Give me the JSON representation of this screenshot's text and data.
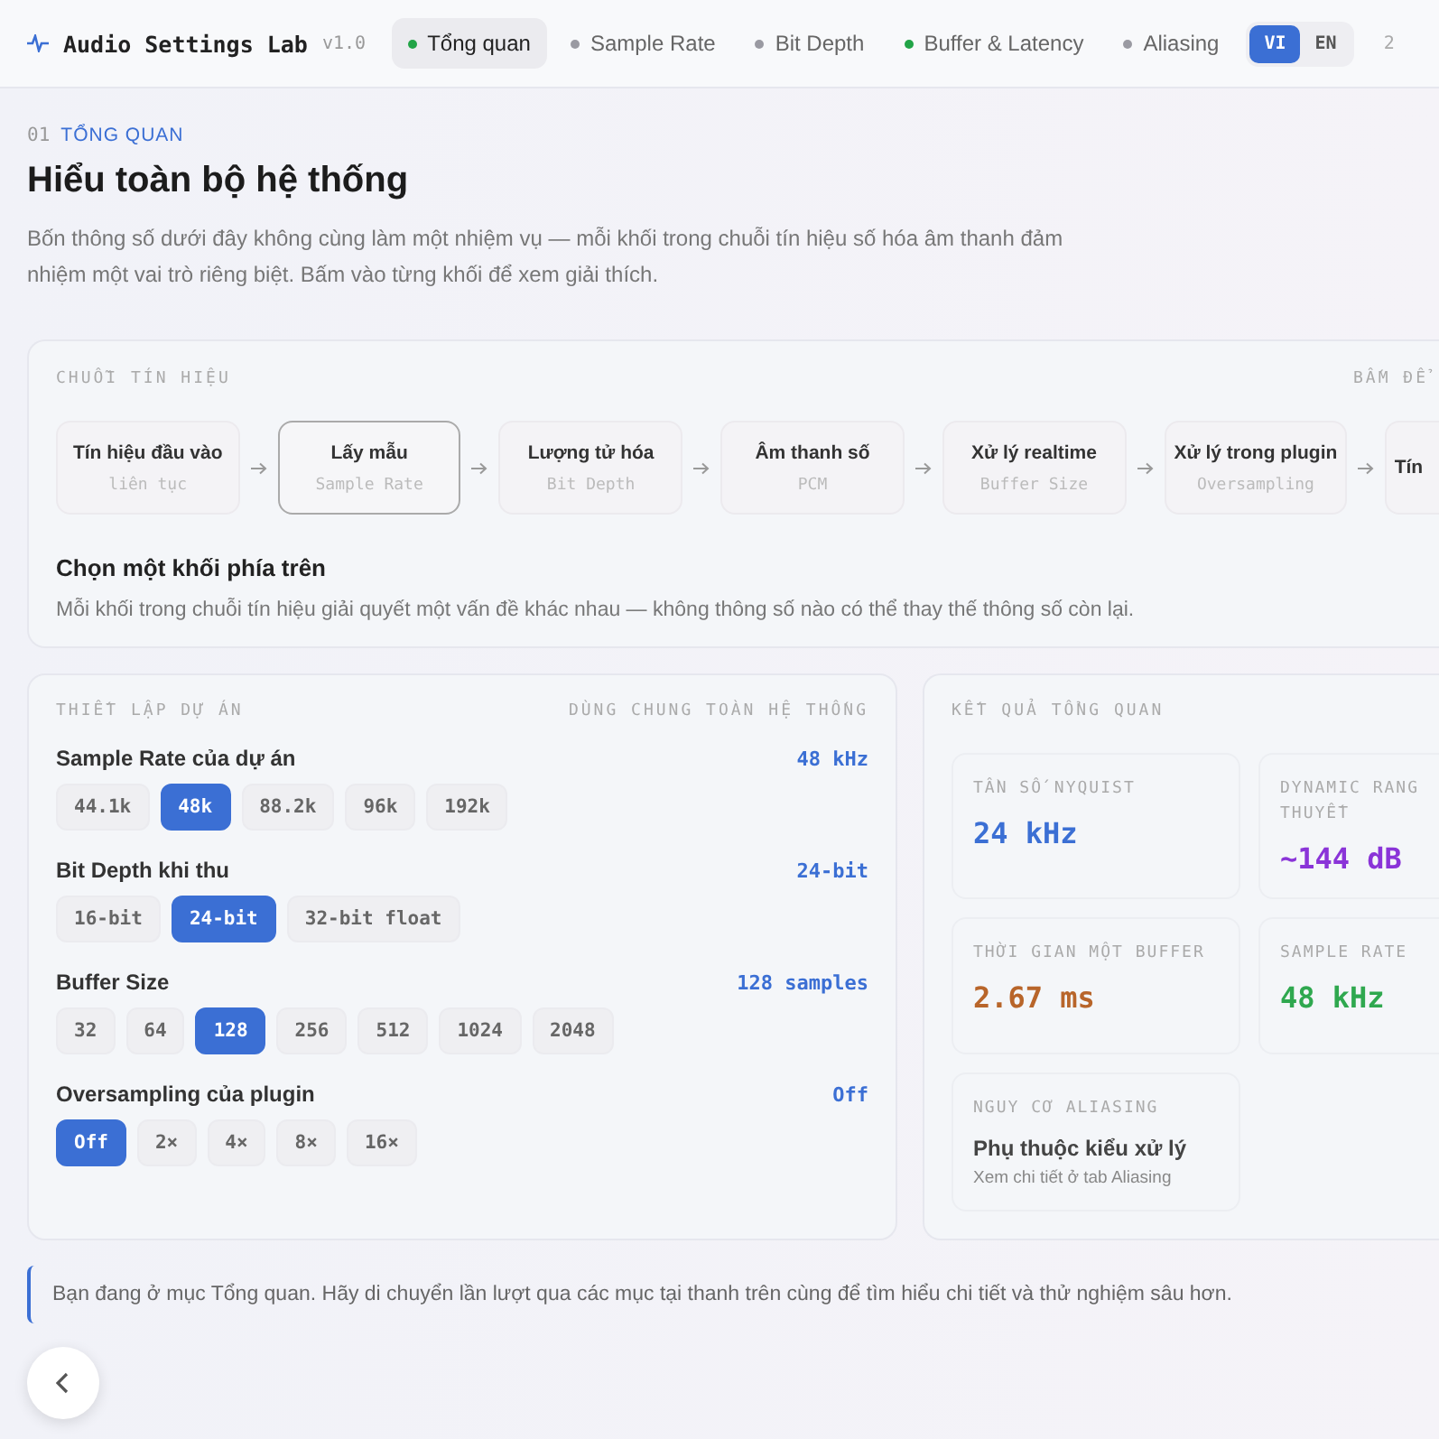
{
  "app": {
    "title": "Audio Settings Lab",
    "version": "v1.0"
  },
  "tabs": [
    {
      "label": "Tổng quan",
      "selected": true,
      "color": "#22a447"
    },
    {
      "label": "Sample Rate",
      "selected": false,
      "color": "#9a9aa2"
    },
    {
      "label": "Bit Depth",
      "selected": false,
      "color": "#9a9aa2"
    },
    {
      "label": "Buffer & Latency",
      "selected": false,
      "color": "#22a447"
    },
    {
      "label": "Aliasing",
      "selected": false,
      "color": "#9a9aa2"
    }
  ],
  "languages": [
    {
      "label": "VI",
      "selected": true
    },
    {
      "label": "EN",
      "selected": false
    }
  ],
  "page_counter": "2",
  "section": {
    "number": "01",
    "label": "TỔNG QUAN",
    "title": "Hiểu toàn bộ hệ thống",
    "intro": "Bốn thông số dưới đây không cùng làm một nhiệm vụ — mỗi khối trong chuỗi tín hiệu số hóa âm thanh đảm nhiệm một vai trò riêng biệt. Bấm vào từng khối để xem giải thích."
  },
  "chain": {
    "label": "CHUỖI TÍN HIỆU",
    "hint": "BẤM ĐỂ",
    "nodes": [
      {
        "title": "Tín hiệu đầu vào",
        "subtitle": "liên tục",
        "selected": false
      },
      {
        "title": "Lấy mẫu",
        "subtitle": "Sample Rate",
        "selected": true
      },
      {
        "title": "Lượng tử hóa",
        "subtitle": "Bit Depth",
        "selected": false
      },
      {
        "title": "Âm thanh số",
        "subtitle": "PCM",
        "selected": false
      },
      {
        "title": "Xử lý realtime",
        "subtitle": "Buffer Size",
        "selected": false
      },
      {
        "title": "Xử lý trong plugin",
        "subtitle": "Oversampling",
        "selected": false
      },
      {
        "title": "Tín",
        "selected": false
      }
    ],
    "detail_title": "Chọn một khối phía trên",
    "detail_text": "Mỗi khối trong chuỗi tín hiệu giải quyết một vấn đề khác nhau — không thông số nào có thể thay thế thông số còn lại."
  },
  "settings": {
    "label": "THIẾT LẬP DỰ ÁN",
    "note": "DÙNG CHUNG TOÀN HỆ THỐNG",
    "groups": [
      {
        "title": "Sample Rate của dự án",
        "value": "48 kHz",
        "options": [
          {
            "label": "44.1k",
            "selected": false
          },
          {
            "label": "48k",
            "selected": true
          },
          {
            "label": "88.2k",
            "selected": false
          },
          {
            "label": "96k",
            "selected": false
          },
          {
            "label": "192k",
            "selected": false
          }
        ]
      },
      {
        "title": "Bit Depth khi thu",
        "value": "24-bit",
        "options": [
          {
            "label": "16-bit",
            "selected": false
          },
          {
            "label": "24-bit",
            "selected": true
          },
          {
            "label": "32-bit float",
            "selected": false
          }
        ]
      },
      {
        "title": "Buffer Size",
        "value": "128 samples",
        "options": [
          {
            "label": "32",
            "selected": false
          },
          {
            "label": "64",
            "selected": false
          },
          {
            "label": "128",
            "selected": true
          },
          {
            "label": "256",
            "selected": false
          },
          {
            "label": "512",
            "selected": false
          },
          {
            "label": "1024",
            "selected": false
          },
          {
            "label": "2048",
            "selected": false
          }
        ]
      },
      {
        "title": "Oversampling của plugin",
        "value": "Off",
        "options": [
          {
            "label": "Off",
            "selected": true
          },
          {
            "label": "2×",
            "selected": false
          },
          {
            "label": "4×",
            "selected": false
          },
          {
            "label": "8×",
            "selected": false
          },
          {
            "label": "16×",
            "selected": false
          }
        ]
      }
    ]
  },
  "results": {
    "label": "KẾT QUẢ TỔNG QUAN",
    "metrics": [
      {
        "kind": "value",
        "label": "TẦN SỐ NYQUIST",
        "value": "24 kHz",
        "color": "#3b6fd4"
      },
      {
        "kind": "value",
        "label": "DYNAMIC RANG THUYẾT",
        "value": "~144 dB",
        "color": "#8a34d8"
      },
      {
        "kind": "value",
        "label": "THỜI GIAN MỘT BUFFER",
        "value": "2.67 ms",
        "color": "#b8652a"
      },
      {
        "kind": "value",
        "label": "SAMPLE RATE",
        "value": "48 kHz",
        "color": "#2fa84f"
      },
      {
        "kind": "text",
        "label": "NGUY CƠ ALIASING",
        "value": "Phụ thuộc kiểu xử lý",
        "note": "Xem chi tiết ở tab Aliasing"
      }
    ]
  },
  "footer_note": "Bạn đang ở mục Tổng quan. Hãy di chuyển lần lượt qua các mục tại thanh trên cùng để tìm hiểu chi tiết và thử nghiệm sâu hơn."
}
